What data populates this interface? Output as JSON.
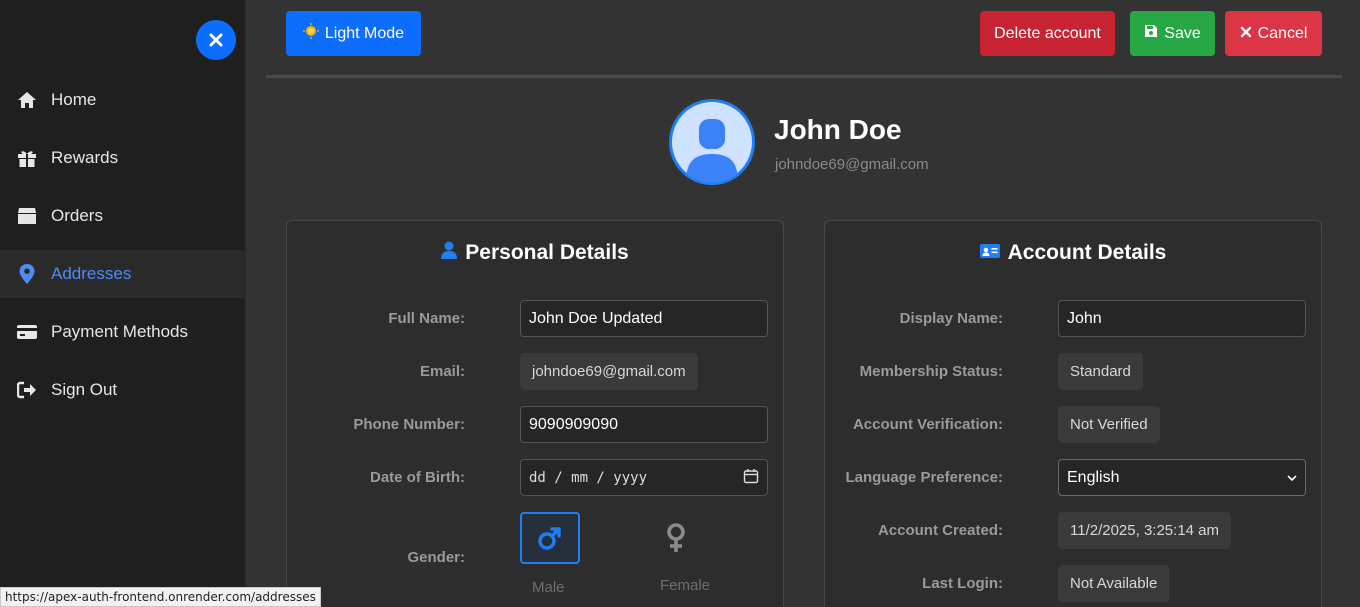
{
  "sidebar": {
    "items": [
      {
        "label": "Home",
        "icon": "home-icon"
      },
      {
        "label": "Rewards",
        "icon": "gift-icon"
      },
      {
        "label": "Orders",
        "icon": "box-icon"
      },
      {
        "label": "Addresses",
        "icon": "map-pin-icon",
        "active": true
      },
      {
        "label": "Payment Methods",
        "icon": "credit-card-icon"
      },
      {
        "label": "Sign Out",
        "icon": "sign-out-icon"
      }
    ]
  },
  "toolbar": {
    "light_mode_label": "Light Mode",
    "delete_label": "Delete account",
    "save_label": "Save",
    "cancel_label": "Cancel"
  },
  "profile": {
    "name": "John Doe",
    "email": "johndoe69@gmail.com"
  },
  "personal": {
    "title": "Personal Details",
    "full_name_label": "Full Name:",
    "full_name_value": "John  Doe Updated",
    "email_label": "Email:",
    "email_value": "johndoe69@gmail.com",
    "phone_label": "Phone Number:",
    "phone_value": "9090909090",
    "dob_label": "Date of Birth:",
    "dob_placeholder": "dd / mm / yyyy",
    "gender_label": "Gender:",
    "male_label": "Male",
    "female_label": "Female"
  },
  "account": {
    "title": "Account Details",
    "display_name_label": "Display Name:",
    "display_name_value": "John",
    "membership_label": "Membership Status:",
    "membership_value": "Standard",
    "verification_label": "Account Verification:",
    "verification_value": "Not Verified",
    "language_label": "Language Preference:",
    "language_value": "English",
    "created_label": "Account Created:",
    "created_value": "11/2/2025, 3:25:14 am",
    "last_login_label": "Last Login:",
    "last_login_value": "Not Available"
  },
  "status_bar": {
    "url": "https://apex-auth-frontend.onrender.com/addresses"
  },
  "colors": {
    "primary": "#0d6efd",
    "danger": "#dc3545",
    "danger_dark": "#c82333",
    "success": "#28a745",
    "active_nav": "#4d8cf5"
  }
}
